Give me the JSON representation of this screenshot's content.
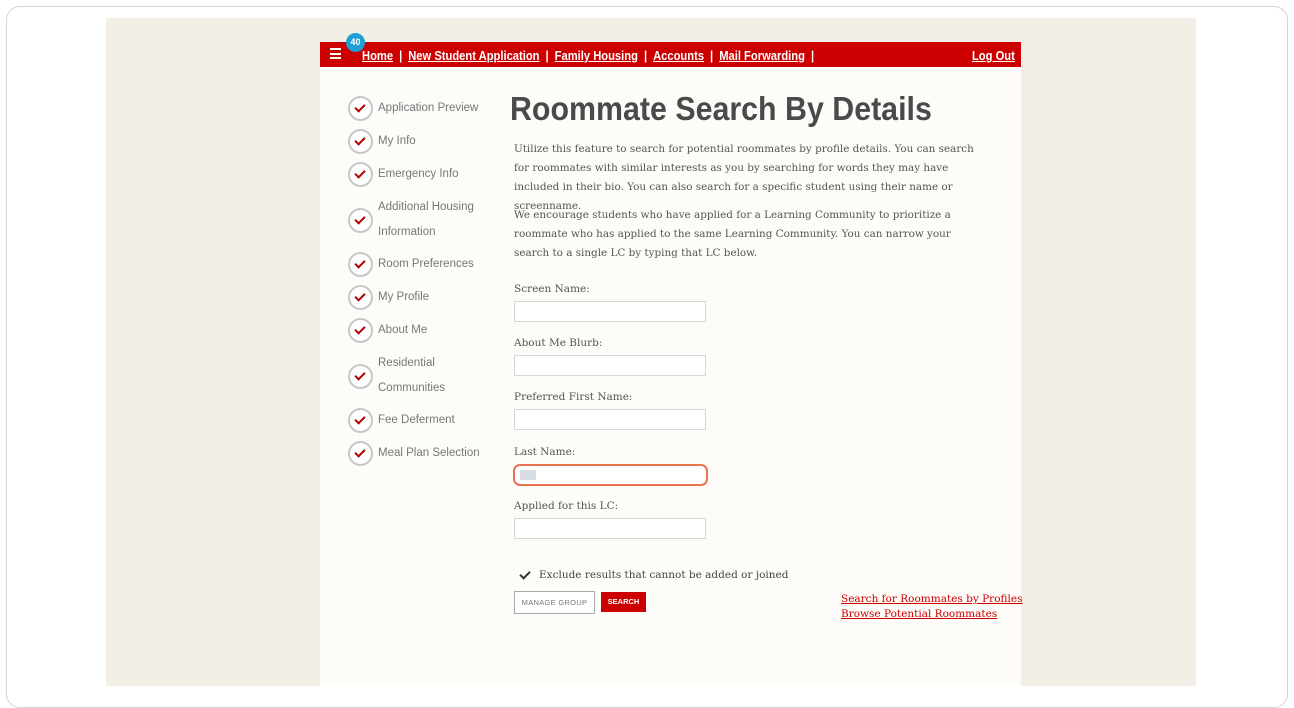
{
  "nav": {
    "badge": "40",
    "links": [
      "Home",
      "New Student Application",
      "Family Housing",
      "Accounts",
      "Mail Forwarding"
    ],
    "separator": "|",
    "logout": "Log Out"
  },
  "steps": [
    "Application Preview",
    "My Info",
    "Emergency Info",
    "Additional Housing Information",
    "Room Preferences",
    "My Profile",
    "About Me",
    "Residential Communities",
    "Fee Deferment",
    "Meal Plan Selection"
  ],
  "main": {
    "title": "Roommate Search By Details",
    "para1": "Utilize this feature to search for potential roommates by profile details. You can search for roommates with similar interests as you by searching for words they may have included in their bio. You can also search for a specific student using their name or screenname.",
    "para2": "We encourage students who have applied for a Learning Community to prioritize a roommate who has applied to the same Learning Community. You can narrow your search to a single LC by typing that LC below.",
    "fields": {
      "screen_name": {
        "label": "Screen Name:",
        "value": ""
      },
      "about_me": {
        "label": "About Me Blurb:",
        "value": ""
      },
      "first_name": {
        "label": "Preferred First Name:",
        "value": ""
      },
      "last_name": {
        "label": "Last Name:",
        "value": ""
      },
      "lc": {
        "label": "Applied for this LC:",
        "value": ""
      }
    },
    "exclude_label": "Exclude results that cannot be added or joined",
    "exclude_checked": true,
    "manage_group": "MANAGE GROUP",
    "search": "SEARCH",
    "link_profiles": "Search for Roommates by Profiles",
    "link_browse": "Browse Potential Roommates"
  },
  "colors": {
    "brand_red": "#cc0000",
    "badge_blue": "#1e9fd6",
    "focus_ring": "#e8744f",
    "page_bg": "#f3efe6"
  }
}
